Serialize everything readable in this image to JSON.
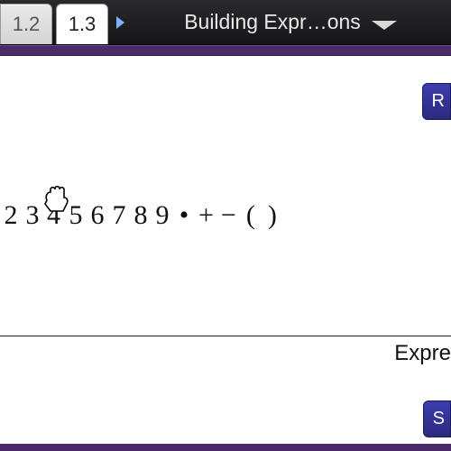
{
  "tabs": [
    {
      "label": "1.2",
      "active": false
    },
    {
      "label": "1.3",
      "active": true
    }
  ],
  "title": "Building Expr…ons",
  "buttons": {
    "top_right": "R",
    "bottom_right": "S"
  },
  "tiles": [
    "2",
    "3",
    "4",
    "5",
    "6",
    "7",
    "8",
    "9",
    "•",
    "+",
    "−",
    "(",
    ")"
  ],
  "grabbed_tile_index": 2,
  "expression_label": "Expre"
}
